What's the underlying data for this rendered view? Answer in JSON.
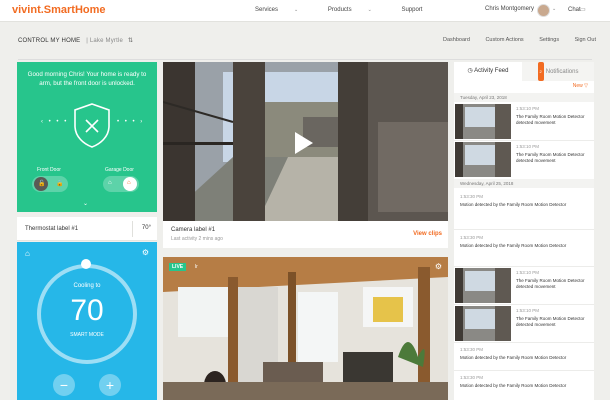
{
  "header": {
    "logo": "vivint.SmartHome",
    "nav": [
      "Services",
      "Products",
      "Support"
    ],
    "user_name": "Chris Montgomery",
    "chat": "Chat"
  },
  "subheader": {
    "title": "CONTROL MY HOME",
    "location": "Lake Myrtle",
    "links": [
      "Dashboard",
      "Custom Actions",
      "Settings",
      "Sign Out"
    ]
  },
  "security": {
    "greeting": "Good morning Chris! Your home is ready to arm, but the front door is unlocked.",
    "front_door": "Front Door",
    "garage_door": "Garage Door"
  },
  "thermostat": {
    "label": "Thermostat label #1",
    "temp": "70°",
    "mode_text": "Cooling to",
    "setpoint": "70",
    "sub_mode": "SMART MODE"
  },
  "camera1": {
    "name": "Camera label #1",
    "sub": "Last activity 2 mins ago",
    "view_clips": "View clips"
  },
  "camera2": {
    "live": "LIVE",
    "sub": "lr"
  },
  "feed": {
    "tab_activity": "Activity Feed",
    "tab_notifications": "Notifications",
    "notif_count": "2",
    "new_label": "New",
    "date1": "Tuesday, April 23, 2018",
    "date2": "Wednesday, April 25, 2018",
    "events": [
      {
        "time": "1:53:10 PM",
        "text": "The Family Room Motion Detector detected movement"
      },
      {
        "time": "1:53:10 PM",
        "text": "The Family Room Motion Detector detected movement"
      },
      {
        "time": "1:53:30 PM",
        "text": "Motion detected by the Family Room Motion Detector"
      },
      {
        "time": "1:53:30 PM",
        "text": "Motion detected by the Family Room Motion Detector"
      },
      {
        "time": "1:53:10 PM",
        "text": "The Family Room Motion Detector detected movement"
      },
      {
        "time": "1:53:10 PM",
        "text": "The Family Room Motion Detector detected movement"
      },
      {
        "time": "1:53:30 PM",
        "text": "Motion detected by the Family Room Motion Detector"
      },
      {
        "time": "1:53:30 PM",
        "text": "Motion detected by the Family Room Motion Detector"
      }
    ]
  },
  "colors": {
    "accent": "#f26b21",
    "security_green": "#27c58c",
    "thermostat_blue": "#26b7e8"
  },
  "icons": [
    "shield-check-icon",
    "lock-icon",
    "garage-icon",
    "home-icon",
    "gear-icon",
    "play-icon",
    "chevron-down-icon",
    "clock-icon"
  ]
}
